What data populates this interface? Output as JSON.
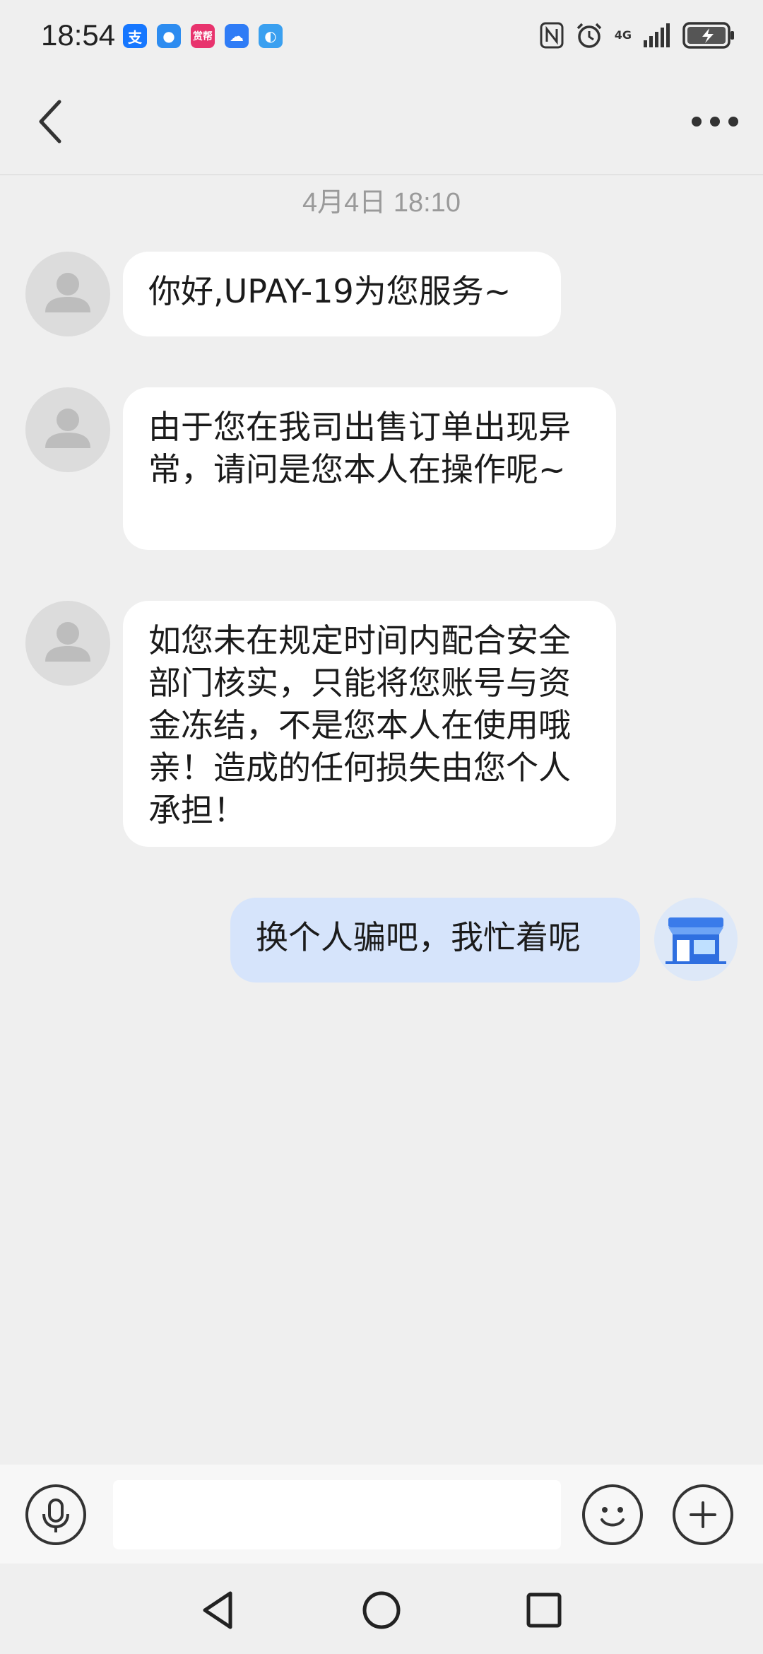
{
  "status_bar": {
    "time": "18:54",
    "notification_icons": [
      {
        "name": "alipay-icon",
        "glyph": "支",
        "color": "#1677ff"
      },
      {
        "name": "message-app-icon",
        "glyph": "●",
        "color": "#2d8cf0"
      },
      {
        "name": "reward-app-icon",
        "glyph": "赏帮",
        "color": "#e8336d"
      },
      {
        "name": "cloud-app-icon",
        "glyph": "☁",
        "color": "#2f7cf6"
      },
      {
        "name": "browser-app-icon",
        "glyph": "◐",
        "color": "#3aa0f0"
      }
    ],
    "network_label": "4G"
  },
  "chat": {
    "timestamp": "4月4日 18:10",
    "messages": [
      {
        "direction": "in",
        "text": "你好,UPAY-19为您服务~"
      },
      {
        "direction": "in",
        "text": "由于您在我司出售订单出现异常，请问是您本人在操作呢~"
      },
      {
        "direction": "in",
        "text": "如您未在规定时间内配合安全部门核实，只能将您账号与资金冻结，不是您本人在使用哦亲！造成的任何损失由您个人承担！"
      },
      {
        "direction": "out",
        "text": "换个人骗吧，我忙着呢"
      }
    ]
  },
  "input": {
    "value": "",
    "placeholder": ""
  },
  "colors": {
    "background": "#efefef",
    "incoming_bubble": "#ffffff",
    "outgoing_bubble": "#d6e4fb"
  }
}
